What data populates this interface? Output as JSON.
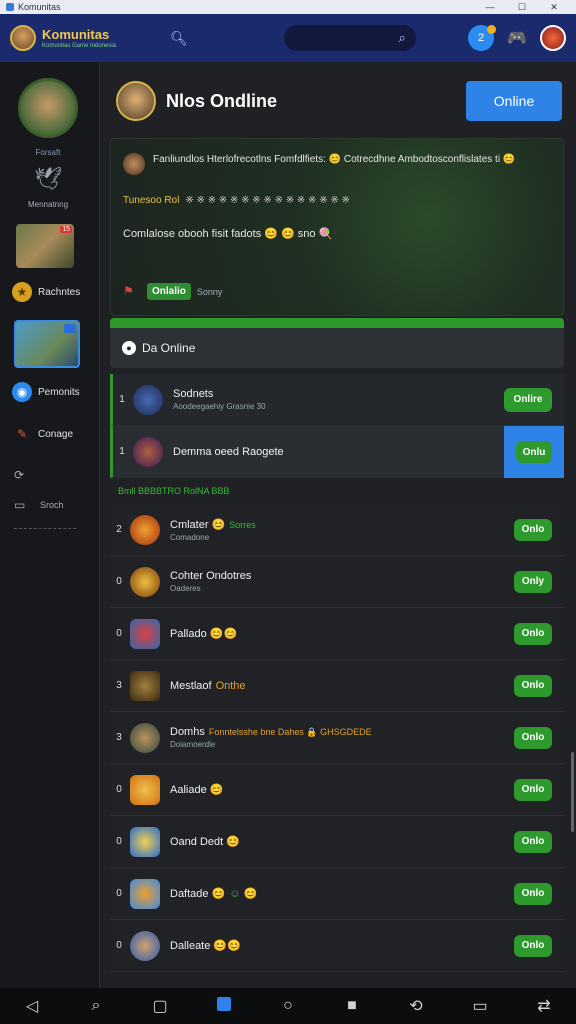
{
  "window": {
    "title": "Komunitas"
  },
  "header": {
    "app_name": "Komunitas",
    "app_tagline": "Komunitas Game Indonesia",
    "badge_count": "2"
  },
  "sidebar": {
    "profile_label": "Forsaft",
    "item_bird_label": "Mennatnng",
    "thumb1_badge": "15",
    "item_rewards_label": "Rachntes",
    "item_moments_label": "Pemonits",
    "item_connect_label": "Conage",
    "item_search_label": "Sroch"
  },
  "main": {
    "title": "Nlos Ondline",
    "online_button": "Online",
    "feature": {
      "line1": "Fanliundlos Hterlofrecotlns Fomfdlfiets: 😊 Cotrecdhne Ambodtosconflislates ti 😊",
      "line2_highlight": "Tunesoo Rol",
      "line2_rest": "※ ※ ※ ※ ※ ※ ※ ※ ※ ※ ※ ※ ※ ※ ※",
      "line3": "Comlalose obooh fisit fadots 😊 😊 sno 🍭",
      "chip": "Onlalio",
      "chip_note": "Sonny"
    },
    "section_title": "Da Online",
    "rows_top": [
      {
        "num": "1",
        "name": "Sodnets",
        "sub": "Aoodeegaehiy Grasnie 30",
        "button": "Onlire"
      },
      {
        "num": "1",
        "name": "Demma oeed Raogete",
        "sub": "",
        "button": "Onlu"
      }
    ],
    "divider": "Bmll BBBBTRO RolNA BBB",
    "rows": [
      {
        "num": "2",
        "name": "Cmlater 😊",
        "extra": "Sorres",
        "sub": "Comadone",
        "button": "Onlo"
      },
      {
        "num": "0",
        "name": "Cohter Ondotres",
        "extra": "",
        "sub": "Oaderes",
        "button": "Only"
      },
      {
        "num": "0",
        "name": "Pallado 😊😊",
        "extra": "",
        "sub": "",
        "button": "Onlo"
      },
      {
        "num": "3",
        "name": "Mestlaof",
        "extra": "Onthe",
        "sub": "",
        "button": "Onlo"
      },
      {
        "num": "3",
        "name": "Domhs",
        "extra": "Fonntelsshe bne Dahes 🔒 GHSGDEDE",
        "sub": "Doiamoerdle",
        "button": "Onlo"
      },
      {
        "num": "0",
        "name": "Aaliade 😊",
        "extra": "",
        "sub": "",
        "button": "Onlo"
      },
      {
        "num": "0",
        "name": "Oand Dedt 😊",
        "extra": "",
        "sub": "",
        "button": "Onlo"
      },
      {
        "num": "0",
        "name": "Daftade 😊",
        "extra": "☺ 😊",
        "sub": "",
        "button": "Onlo"
      },
      {
        "num": "0",
        "name": "Dalleate 😊😊",
        "extra": "",
        "sub": "",
        "button": "Onlo"
      }
    ]
  },
  "colors": {
    "header_bg": "#1a2a6c",
    "accent_blue": "#2f83e6",
    "accent_green": "#2e9a2e"
  }
}
